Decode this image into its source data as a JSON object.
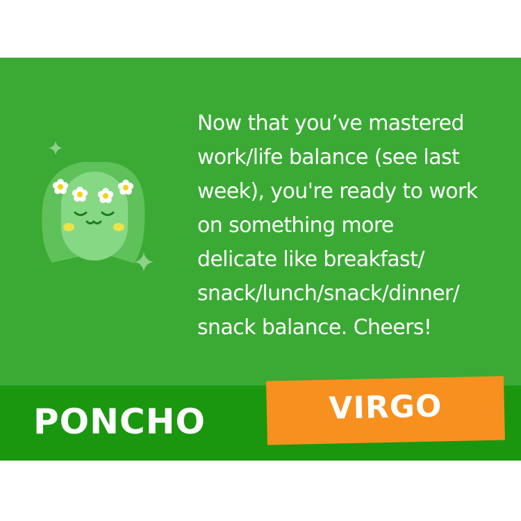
{
  "card": {
    "message": "Now that you’ve mastered\nwork/life balance (see last\nweek), you're ready to work\non something more\ndelicate like breakfast/\nsnack/lunch/snack/dinner/\nsnack balance. Cheers!",
    "brand": "PONCHO",
    "sign": "VIRGO"
  },
  "icons": {
    "character": "virgo-character-icon",
    "sparkle": "sparkle-icon",
    "flower": "daisy-flower-icon"
  },
  "colors": {
    "background": "#3aaa35",
    "footer": "#1a970f",
    "sign_badge": "#f7901e",
    "text": "#ffffff"
  }
}
